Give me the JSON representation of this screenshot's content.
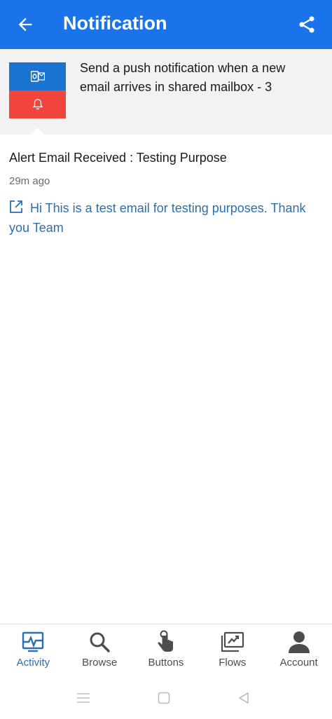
{
  "app_bar": {
    "title": "Notification",
    "back_icon": "arrow-left-icon",
    "share_icon": "share-icon",
    "color": "#1a73e8"
  },
  "flow": {
    "name": "Send a push notification when a new email arrives in shared mailbox - 3",
    "icons": [
      "outlook-icon",
      "bell-icon"
    ]
  },
  "notification": {
    "title": "Alert Email Received : Testing Purpose",
    "time": "29m ago",
    "link_text": "Hi This is a test email for testing purposes. Thank you Team",
    "link_icon": "external-link-icon"
  },
  "bottom_nav": {
    "items": [
      {
        "label": "Activity",
        "icon": "activity-icon",
        "active": true
      },
      {
        "label": "Browse",
        "icon": "search-icon",
        "active": false
      },
      {
        "label": "Buttons",
        "icon": "tap-icon",
        "active": false
      },
      {
        "label": "Flows",
        "icon": "flows-icon",
        "active": false
      },
      {
        "label": "Account",
        "icon": "account-icon",
        "active": false
      }
    ]
  },
  "system_nav": {
    "buttons": [
      "menu-icon",
      "home-icon",
      "back-icon"
    ]
  }
}
